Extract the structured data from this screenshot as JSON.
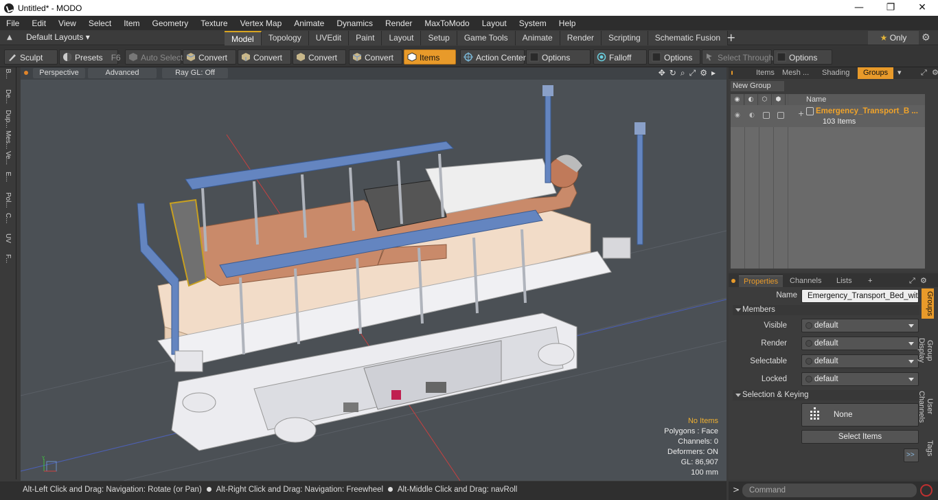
{
  "window": {
    "title": "Untitled* - MODO",
    "minimize": "—",
    "maximize": "❐",
    "close": "✕"
  },
  "menu": [
    "File",
    "Edit",
    "View",
    "Select",
    "Item",
    "Geometry",
    "Texture",
    "Vertex Map",
    "Animate",
    "Dynamics",
    "Render",
    "MaxToModo",
    "Layout",
    "System",
    "Help"
  ],
  "layoutbar": {
    "layouts_label": "Default Layouts ▾",
    "tabs": [
      "Model",
      "Topology",
      "UVEdit",
      "Paint",
      "Layout",
      "Setup",
      "Game Tools",
      "Animate",
      "Render",
      "Scripting",
      "Schematic Fusion"
    ],
    "active_tab": "Model",
    "only_label": "Only",
    "plus": "+"
  },
  "toolbar": {
    "sculpt": "Sculpt",
    "presets": "Presets",
    "presets_key": "F6",
    "auto_select": "Auto Select",
    "convert": "Convert",
    "items": "Items",
    "action_center": "Action Center",
    "options": "Options",
    "falloff": "Falloff",
    "select_through": "Select Through"
  },
  "leftstrip": [
    "B...",
    "De...",
    "Dup...",
    "Mes...",
    "Ve...",
    "E...",
    "Pol...",
    "C...",
    "UV",
    "F..."
  ],
  "viewport": {
    "view_mode": "Perspective",
    "shading": "Advanced",
    "raygl": "Ray GL: Off",
    "icons": [
      "✥",
      "↻",
      "⌕",
      "⤢",
      "⚙",
      "▸"
    ],
    "stats": {
      "selection": "No Items",
      "polygons": "Polygons : Face",
      "channels": "Channels: 0",
      "deformers": "Deformers: ON",
      "gl": "GL: 86,907",
      "scale": "100 mm"
    }
  },
  "status": {
    "hint1": "Alt-Left Click and Drag: Navigation: Rotate (or Pan)",
    "hint2": "Alt-Right Click and Drag: Navigation: Freewheel",
    "hint3": "Alt-Middle Click and Drag: navRoll"
  },
  "groups_panel": {
    "tabs": [
      "Items",
      "Mesh ...",
      "Shading",
      "Groups"
    ],
    "active_tab": "Groups",
    "new_group": "New Group",
    "col_name": "Name",
    "group_name": "Emergency_Transport_B ...",
    "group_count": "103 Items"
  },
  "properties": {
    "tabs": [
      "Properties",
      "Channels",
      "Lists"
    ],
    "active_tab": "Properties",
    "plus": "+",
    "name_label": "Name",
    "name_value": "Emergency_Transport_Bed_with_",
    "members_section": "Members",
    "visible_label": "Visible",
    "render_label": "Render",
    "selectable_label": "Selectable",
    "locked_label": "Locked",
    "dropdown_value": "default",
    "selection_section": "Selection & Keying",
    "none_label": "None",
    "select_items": "Select Items",
    "expand": ">>"
  },
  "side_tabs": [
    "Groups",
    "Group Display",
    "User Channels",
    "Tags"
  ],
  "command": {
    "placeholder": "Command",
    "prompt": ">"
  },
  "colors": {
    "accent": "#e89a2a",
    "viewport_bg": "#4b5055",
    "bed_rail": "#5d7fbf"
  }
}
